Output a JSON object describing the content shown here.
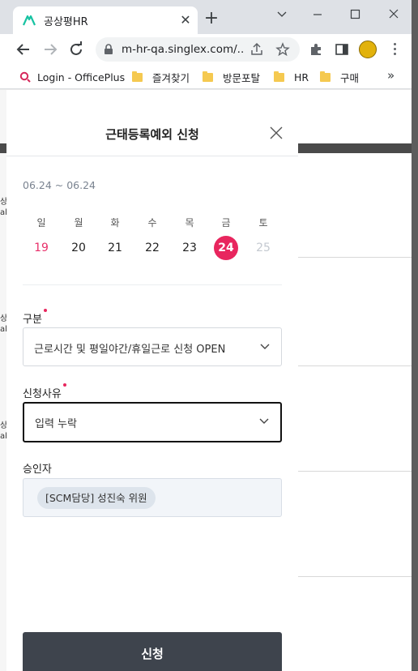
{
  "browser": {
    "tab_title": "공상평HR",
    "url": "m-hr-qa.singlex.com/...",
    "bookmarks": [
      {
        "label": "Login - OfficePlus",
        "icon": "officeplus-icon"
      },
      {
        "label": "즐겨찾기",
        "icon": "folder-icon"
      },
      {
        "label": "방문포탈",
        "icon": "folder-icon"
      },
      {
        "label": "HR",
        "icon": "folder-icon"
      },
      {
        "label": "구매",
        "icon": "folder-icon"
      }
    ],
    "more_bookmarks": "»"
  },
  "background_page": {
    "fragments": [
      "상",
      "al",
      "상",
      "al",
      "상",
      "al"
    ]
  },
  "modal": {
    "title": "근태등록예외 신청",
    "period": "06.24 ~ 06.24",
    "weekdays": [
      "일",
      "월",
      "화",
      "수",
      "목",
      "금",
      "토"
    ],
    "days": [
      {
        "date": "19",
        "state": "sunday"
      },
      {
        "date": "20",
        "state": "normal"
      },
      {
        "date": "21",
        "state": "normal"
      },
      {
        "date": "22",
        "state": "normal"
      },
      {
        "date": "23",
        "state": "normal"
      },
      {
        "date": "24",
        "state": "selected"
      },
      {
        "date": "25",
        "state": "disabled"
      }
    ],
    "category": {
      "label": "구분",
      "required": true,
      "value": "근로시간 및 평일야간/휴일근로 신청 OPEN"
    },
    "reason": {
      "label": "신청사유",
      "required": true,
      "value": "입력 누락"
    },
    "approver": {
      "label": "승인자",
      "value": "[SCM담당] 성진숙 위원"
    },
    "submit_label": "신청"
  },
  "colors": {
    "accent": "#e8265e",
    "button": "#3e444d",
    "approver_bg": "#f2f5f9"
  }
}
